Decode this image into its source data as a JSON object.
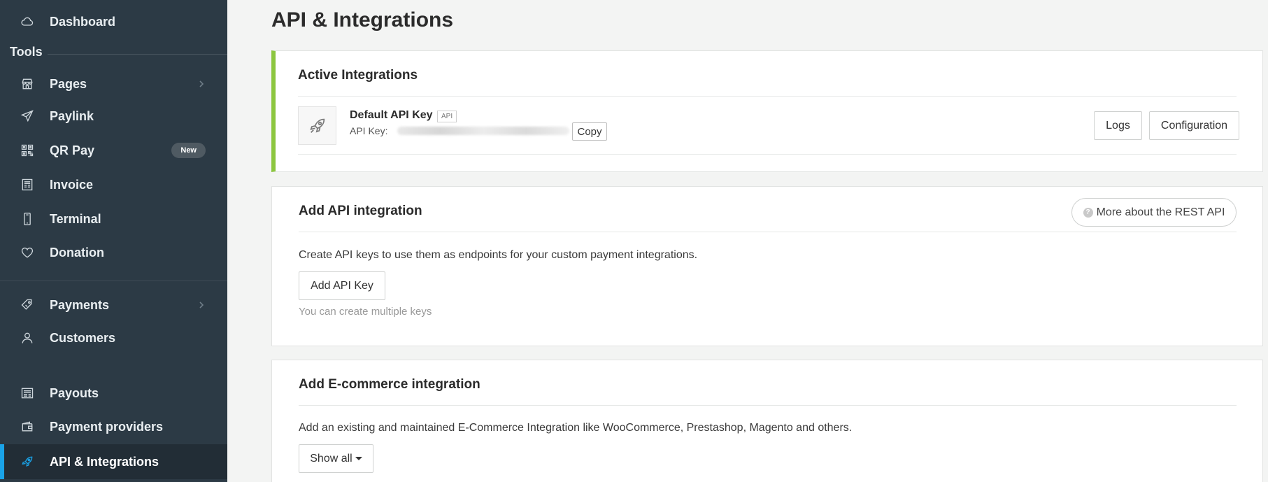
{
  "sidebar": {
    "top_item": {
      "label": "Dashboard",
      "icon": "cloud-icon"
    },
    "section_title": "Tools",
    "tools": [
      {
        "label": "Pages",
        "icon": "store-icon",
        "has_submenu": true
      },
      {
        "label": "Paylink",
        "icon": "paper-plane-icon"
      },
      {
        "label": "QR Pay",
        "icon": "qr-code-icon",
        "badge": "New"
      },
      {
        "label": "Invoice",
        "icon": "invoice-icon"
      },
      {
        "label": "Terminal",
        "icon": "phone-icon"
      },
      {
        "label": "Donation",
        "icon": "heart-icon"
      }
    ],
    "payments": [
      {
        "label": "Payments",
        "icon": "tag-icon",
        "has_submenu": true
      },
      {
        "label": "Customers",
        "icon": "user-icon"
      }
    ],
    "bottom": [
      {
        "label": "Payouts",
        "icon": "payouts-icon"
      },
      {
        "label": "Payment providers",
        "icon": "wallet-icon"
      },
      {
        "label": "API & Integrations",
        "icon": "rocket-icon",
        "active": true
      }
    ],
    "active_color": "#1aa3e8",
    "background": "#2c3a45"
  },
  "main": {
    "title": "API & Integrations",
    "active_integrations": {
      "heading": "Active Integrations",
      "accent_color": "#8cc63f",
      "item": {
        "name": "Default API Key",
        "tag": "API",
        "key_label": "API Key:",
        "copy_label": "Copy",
        "logs_label": "Logs",
        "config_label": "Configuration"
      }
    },
    "add_api": {
      "heading": "Add API integration",
      "more_label": "More about the REST API",
      "description": "Create API keys to use them as endpoints for your custom payment integrations.",
      "add_label": "Add API Key",
      "hint": "You can create multiple keys"
    },
    "add_ecommerce": {
      "heading": "Add E-commerce integration",
      "description": "Add an existing and maintained E-Commerce Integration like WooCommerce, Prestashop, Magento and others.",
      "show_all_label": "Show all"
    }
  }
}
